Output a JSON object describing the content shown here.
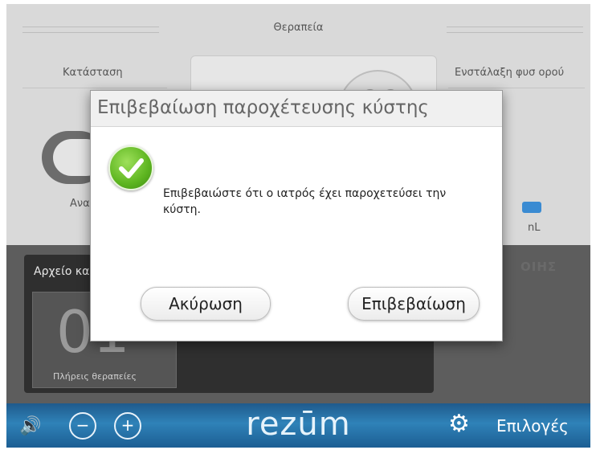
{
  "header": {
    "title": "Θεραπεία"
  },
  "columns": {
    "left_label": "Κατάσταση",
    "right_label": "Ενστάλαξη φυσ ορού"
  },
  "dial": {
    "value": "00"
  },
  "toggle": {
    "partial_label": "Ανα"
  },
  "saline": {
    "partial_unit": "nL"
  },
  "records": {
    "title": "Αρχείο κα",
    "count": "01",
    "subtitle": "Πλήρεις θεραπείες"
  },
  "right_ghost": "ΟΙΗΣ",
  "bottom_bar": {
    "logo": "rezūm",
    "options_label": "Επιλογές"
  },
  "dialog": {
    "title": "Επιβεβαίωση παροχέτευσης κύστης",
    "message": "Επιβεβαιώστε ότι ο ιατρός έχει παροχετεύσει την κύστη.",
    "cancel_label": "Ακύρωση",
    "confirm_label": "Επιβεβαίωση"
  }
}
